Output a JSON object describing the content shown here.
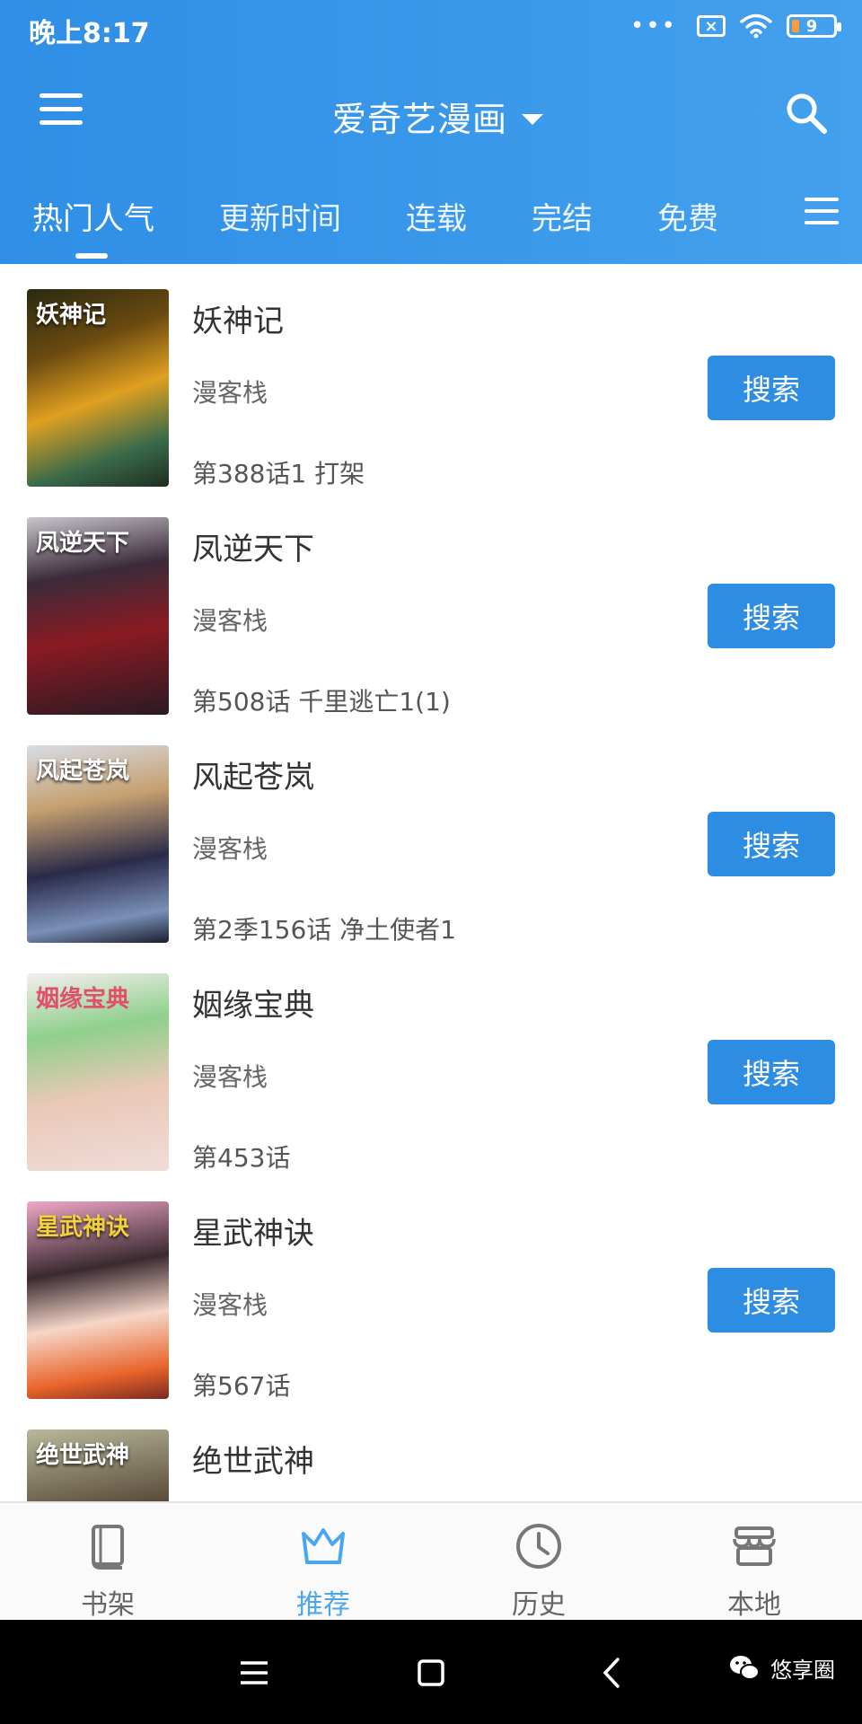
{
  "status_bar": {
    "time": "晚上8:17",
    "dots": "•••",
    "sim_icon_label": "×",
    "battery": "9"
  },
  "app_bar": {
    "title": "爱奇艺漫画",
    "menu_icon": "hamburger-menu-icon",
    "search_icon": "search-icon"
  },
  "tabs": [
    {
      "label": "热门人气",
      "active": true
    },
    {
      "label": "更新时间",
      "active": false
    },
    {
      "label": "连载",
      "active": false
    },
    {
      "label": "完结",
      "active": false
    },
    {
      "label": "免费",
      "active": false
    }
  ],
  "list": [
    {
      "title": "妖神记",
      "source": "漫客栈",
      "chapter": "第388话1 打架",
      "button": "搜索",
      "cover_text": "妖神记"
    },
    {
      "title": "凤逆天下",
      "source": "漫客栈",
      "chapter": "第508话 千里逃亡1(1)",
      "button": "搜索",
      "cover_text": "凤逆天下"
    },
    {
      "title": "风起苍岚",
      "source": "漫客栈",
      "chapter": "第2季156话 净土使者1",
      "button": "搜索",
      "cover_text": "风起苍岚"
    },
    {
      "title": "姻缘宝典",
      "source": "漫客栈",
      "chapter": "第453话",
      "button": "搜索",
      "cover_text": "姻缘宝典"
    },
    {
      "title": "星武神诀",
      "source": "漫客栈",
      "chapter": "第567话",
      "button": "搜索",
      "cover_text": "星武神诀"
    },
    {
      "title": "绝世武神",
      "source": "",
      "chapter": "",
      "button": "",
      "cover_text": "绝世武神"
    }
  ],
  "bottom_nav": [
    {
      "label": "书架",
      "icon": "book-icon",
      "active": false
    },
    {
      "label": "推荐",
      "icon": "crown-icon",
      "active": true
    },
    {
      "label": "历史",
      "icon": "clock-icon",
      "active": false
    },
    {
      "label": "本地",
      "icon": "store-icon",
      "active": false
    }
  ],
  "watermark": {
    "text": "悠享圈"
  },
  "colors": {
    "primary": "#2d8de3",
    "active_nav": "#4aa7ee"
  }
}
